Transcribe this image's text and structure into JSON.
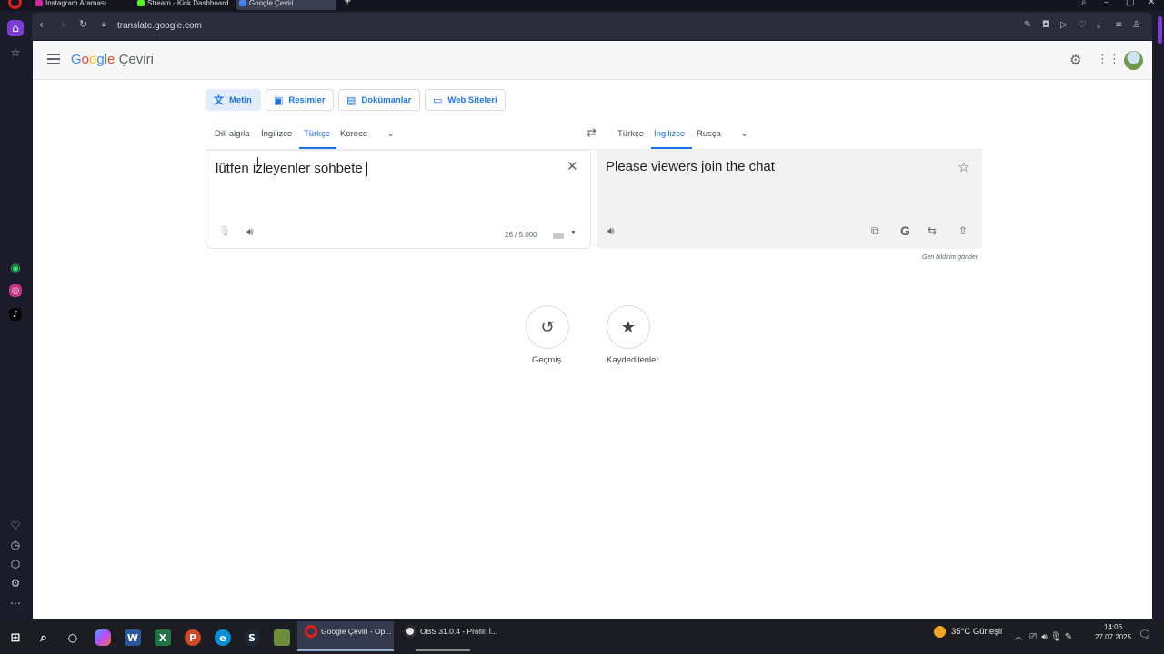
{
  "browser": {
    "tabs": [
      {
        "label": "Instagram Araması",
        "color": "#d6249f"
      },
      {
        "label": "Stream - Kick Dashboard",
        "color": "#53fc18"
      },
      {
        "label": "Google Çeviri",
        "color": "#4285f4"
      }
    ],
    "new_tab": "+",
    "url": "translate.google.com",
    "accent": "#7a3cd3"
  },
  "header": {
    "logo_google": [
      "G",
      "o",
      "o",
      "g",
      "l",
      "e"
    ],
    "logo_product": "Çeviri"
  },
  "modes": [
    {
      "label": "Metin",
      "icon": "translate-icon"
    },
    {
      "label": "Resimler",
      "icon": "image-icon"
    },
    {
      "label": "Dokümanlar",
      "icon": "document-icon"
    },
    {
      "label": "Web Siteleri",
      "icon": "website-icon"
    }
  ],
  "source_langs": [
    "Dili algıla",
    "İngilizce",
    "Türkçe",
    "Korece"
  ],
  "target_langs": [
    "Türkçe",
    "İngilizce",
    "Rusça"
  ],
  "source": {
    "text": "lütfen izleyenler sohbete",
    "count": "26 / 5.000"
  },
  "target": {
    "text": "Please viewers join the chat"
  },
  "feedback": "Geri bildirim gönder",
  "history": {
    "label": "Geçmiş"
  },
  "saved": {
    "label": "Kaydedilenler"
  },
  "taskbar": {
    "apps": [
      {
        "label": "Google Çeviri - Op...",
        "color": "#e0201c"
      },
      {
        "label": "OBS 31.0.4 - Profil: İ...",
        "color": "#e8e8e8"
      }
    ],
    "weather": "35°C  Güneşli",
    "time": "14:06",
    "date": "27.07.2025"
  }
}
